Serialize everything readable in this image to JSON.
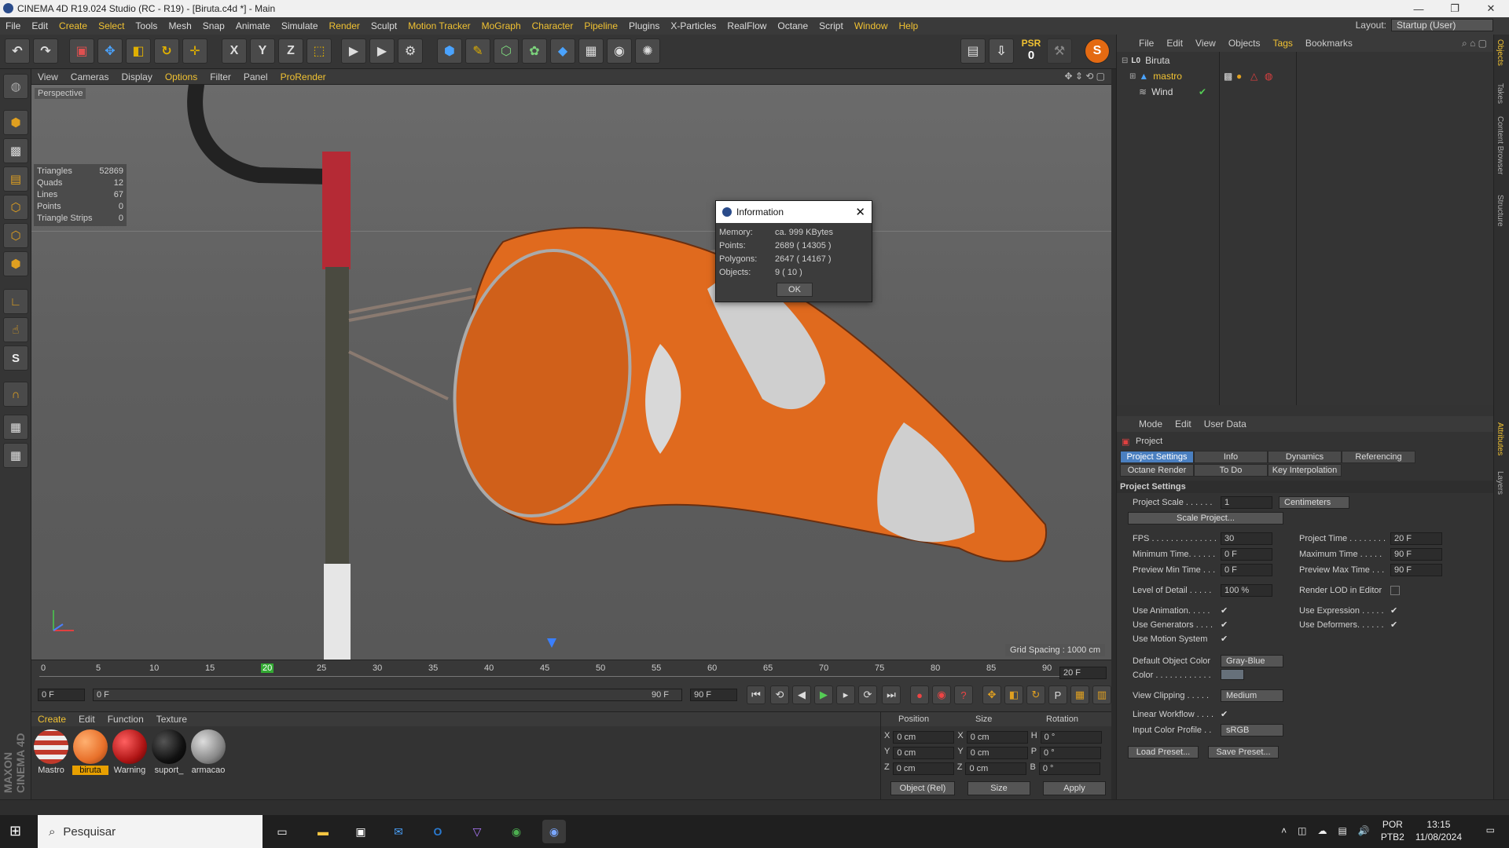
{
  "window": {
    "title": "CINEMA 4D R19.024 Studio (RC - R19) - [Biruta.c4d *] - Main",
    "min": "—",
    "max": "❐",
    "close": "✕"
  },
  "menu": {
    "items": [
      "File",
      "Edit",
      "Create",
      "Select",
      "Tools",
      "Mesh",
      "Snap",
      "Animate",
      "Simulate",
      "Render",
      "Sculpt",
      "Motion Tracker",
      "MoGraph",
      "Character",
      "Pipeline",
      "Plugins",
      "X-Particles",
      "RealFlow",
      "Octane",
      "Script",
      "Window",
      "Help"
    ],
    "layout_label": "Layout:",
    "layout_value": "Startup (User)"
  },
  "toolbar": {
    "psr_label": "PSR",
    "psr_value": "0",
    "axis_x": "X",
    "axis_y": "Y",
    "axis_z": "Z"
  },
  "viewport_menu": {
    "items": [
      "View",
      "Cameras",
      "Display",
      "Options",
      "Filter",
      "Panel",
      "ProRender"
    ]
  },
  "viewport": {
    "label": "Perspective",
    "grid_spacing": "Grid Spacing : 1000 cm",
    "stats": [
      {
        "k": "Triangles",
        "v": "52869"
      },
      {
        "k": "Quads",
        "v": "12"
      },
      {
        "k": "Lines",
        "v": "67"
      },
      {
        "k": "Points",
        "v": "0"
      },
      {
        "k": "Triangle Strips",
        "v": "0"
      }
    ]
  },
  "dialog": {
    "title": "Information",
    "close": "✕",
    "ok": "OK",
    "rows": [
      {
        "k": "Memory:",
        "v": "ca. 999 KBytes"
      },
      {
        "k": "Points:",
        "v": "2689 ( 14305 )"
      },
      {
        "k": "Polygons:",
        "v": "2647 ( 14167 )"
      },
      {
        "k": "Objects:",
        "v": "9 ( 10 )"
      }
    ]
  },
  "timeline": {
    "ticks": [
      "0",
      "5",
      "10",
      "15",
      "20",
      "25",
      "30",
      "35",
      "40",
      "45",
      "50",
      "55",
      "60",
      "65",
      "70",
      "75",
      "80",
      "85",
      "90"
    ],
    "current_frame_label": "20",
    "end_field": "20 F",
    "start": "0 F",
    "range_start": "0 F",
    "range_end": "90 F",
    "end": "90 F"
  },
  "materials": {
    "menu": [
      "Create",
      "Edit",
      "Function",
      "Texture"
    ],
    "items": [
      {
        "name": "Mastro",
        "color": "#c0392b"
      },
      {
        "name": "biruta",
        "color": "#e8702a"
      },
      {
        "name": "Warning",
        "color": "#b01515"
      },
      {
        "name": "suport_",
        "color": "#111111"
      },
      {
        "name": "armacao",
        "color": "#888888"
      }
    ]
  },
  "coords": {
    "headers": [
      "Position",
      "Size",
      "Rotation"
    ],
    "rows": [
      {
        "a": "X",
        "p": "0 cm",
        "s": "X",
        "sv": "0 cm",
        "r": "H",
        "rv": "0 °"
      },
      {
        "a": "Y",
        "p": "0 cm",
        "s": "Y",
        "sv": "0 cm",
        "r": "P",
        "rv": "0 °"
      },
      {
        "a": "Z",
        "p": "0 cm",
        "s": "Z",
        "sv": "0 cm",
        "r": "B",
        "rv": "0 °"
      }
    ],
    "mode": "Object (Rel)",
    "size_mode": "Size",
    "apply": "Apply"
  },
  "objects": {
    "menu": [
      "File",
      "Edit",
      "View",
      "Objects",
      "Tags",
      "Bookmarks"
    ],
    "items": [
      {
        "name": "Biruta"
      },
      {
        "name": "mastro"
      },
      {
        "name": "Wind"
      }
    ]
  },
  "attributes": {
    "menu": [
      "Mode",
      "Edit",
      "User Data"
    ],
    "object": "Project",
    "tabs_row1": [
      "Project Settings",
      "Info",
      "Dynamics",
      "Referencing"
    ],
    "tabs_row2": [
      "Octane Render",
      "To Do",
      "Key Interpolation"
    ],
    "section": "Project Settings",
    "project_scale_label": "Project Scale . . . . . .",
    "project_scale": "1",
    "project_scale_unit": "Centimeters",
    "scale_project": "Scale Project...",
    "fps_label": "FPS . . . . . . . . . . . . . .",
    "fps": "30",
    "project_time_label": "Project Time . . . . . . . .",
    "project_time": "20 F",
    "min_time_label": "Minimum Time. . . . . .",
    "min_time": "0 F",
    "max_time_label": "Maximum Time . . . . .",
    "max_time": "90 F",
    "prev_min_label": "Preview Min Time . . .",
    "prev_min": "0 F",
    "prev_max_label": "Preview Max Time . . .",
    "prev_max": "90 F",
    "lod_label": "Level of Detail . . . . .",
    "lod": "100 %",
    "render_lod_label": "Render LOD in Editor",
    "use_anim_label": "Use Animation. . . . .",
    "use_expr_label": "Use Expression . . . . .",
    "use_gen_label": "Use Generators . . . .",
    "use_def_label": "Use Deformers. . . . . .",
    "use_motion_label": "Use Motion System",
    "def_color_label": "Default Object Color",
    "def_color": "Gray-Blue",
    "color_label": "Color . . . . . . . . . . . .",
    "view_clip_label": "View Clipping . . . . .",
    "view_clip": "Medium",
    "lin_work_label": "Linear Workflow . . . .",
    "input_profile_label": "Input Color Profile . .",
    "input_profile": "sRGB",
    "load_preset": "Load Preset...",
    "save_preset": "Save Preset...",
    "check": "✔"
  },
  "sidetabs": [
    "Objects",
    "Takes",
    "Content Browser",
    "Structure",
    "Attributes",
    "Layers"
  ],
  "taskbar": {
    "search": "Pesquisar",
    "lang1": "POR",
    "lang2": "PTB2",
    "time": "13:15",
    "date": "11/08/2024"
  },
  "logo": "MAXON CINEMA 4D"
}
